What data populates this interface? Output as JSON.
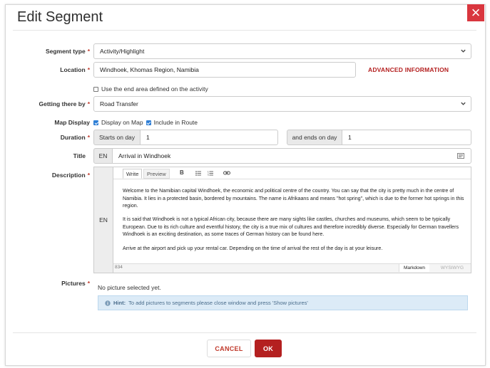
{
  "dialog": {
    "title": "Edit Segment",
    "close_label": "×"
  },
  "segment_type": {
    "label": "Segment type",
    "required": "*",
    "value": "Activity/Highlight"
  },
  "location": {
    "label": "Location",
    "required": "*",
    "value": "Windhoek, Khomas Region, Namibia",
    "advanced_link": "ADVANCED INFORMATION"
  },
  "end_area": {
    "label": "Use the end area defined on the activity",
    "checked": false
  },
  "getting_there": {
    "label": "Getting there by",
    "required": "*",
    "value": "Road Transfer"
  },
  "map_display": {
    "label": "Map Display",
    "display_on_map": "Display on Map",
    "include_in_route": "Include in Route"
  },
  "duration": {
    "label": "Duration",
    "required": "*",
    "starts_label": "Starts on day",
    "starts_value": "1",
    "ends_label": "and ends on day",
    "ends_value": "1"
  },
  "title_field": {
    "label": "Title",
    "lang": "EN",
    "value": "Arrival in Windhoek"
  },
  "description": {
    "label": "Description",
    "required": "*",
    "lang": "EN",
    "tab_write": "Write",
    "tab_preview": "Preview",
    "paragraphs": [
      "Welcome to the Namibian capital Windhoek, the economic and political centre of the country. You can say that the city is pretty much in the centre of Namibia. It lies in a protected basin, bordered by mountains. The name is Afrikaans and means \"hot spring\", which is due to the former hot springs in this region.",
      "It is said that Windhoek is not a typical African city, because there are many sights like castles, churches and museums, which seem to be typically European. Due to its rich culture and eventful history, the city is a true mix of cultures and therefore incredibly diverse. Especially for German travellers Windhoek is an exciting destination, as some traces of German history can be found here.",
      "Arrive at the airport and pick up your rental car. Depending on the time of arrival the rest of the day is at your leisure."
    ],
    "char_count": "834",
    "mode_markdown": "Markdown",
    "mode_wysiwyg": "WYSIWYG"
  },
  "pictures": {
    "label": "Pictures",
    "required": "*",
    "empty_text": "No picture selected yet.",
    "hint_bold": "Hint:",
    "hint_text": "To add pictures to segments please close window and press 'Show pictures'"
  },
  "footer": {
    "cancel_label": "CANCEL",
    "ok_label": "OK"
  },
  "colors": {
    "accent": "#b42020",
    "checkbox": "#2f7fd6",
    "hint_bg": "#dcebf7"
  },
  "icons": {
    "close": "close-icon",
    "chevron": "chevron-down-icon",
    "bold": "bold-icon",
    "ul": "bullet-list-icon",
    "ol": "numbered-list-icon",
    "link": "link-icon",
    "info": "info-icon",
    "text_block": "text-block-icon"
  }
}
